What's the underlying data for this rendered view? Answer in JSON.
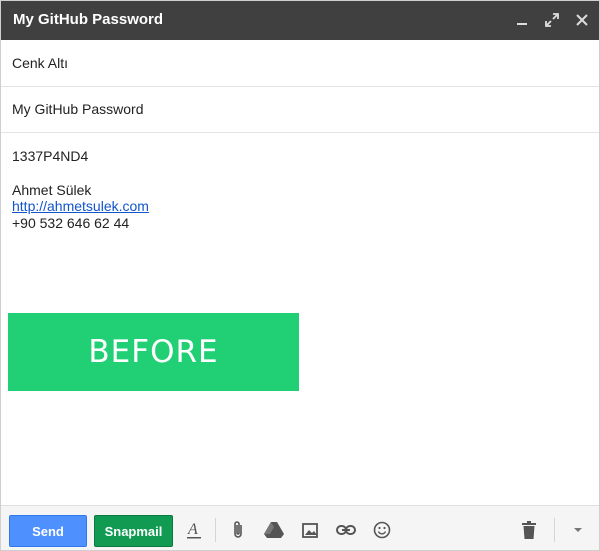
{
  "window": {
    "title": "My GitHub Password",
    "controls": [
      "minimize-icon",
      "expand-icon",
      "close-icon"
    ]
  },
  "compose": {
    "to": "Cenk Altı",
    "subject": "My GitHub Password",
    "body": {
      "line1": "1337P4ND4",
      "signature_name": "Ahmet Sülek",
      "signature_link": "http://ahmetsulek.com",
      "signature_phone": "+90 532 646 62 44"
    },
    "banner": {
      "text": "BEFORE",
      "color": "#21d074"
    }
  },
  "toolbar": {
    "send_label": "Send",
    "snapmail_label": "Snapmail",
    "icons": [
      "formatting-icon",
      "attach-icon",
      "drive-icon",
      "photo-icon",
      "link-icon",
      "emoji-icon",
      "trash-icon",
      "more-options-icon"
    ],
    "colors": {
      "send": "#4d90fe",
      "snapmail": "#109a52"
    }
  }
}
